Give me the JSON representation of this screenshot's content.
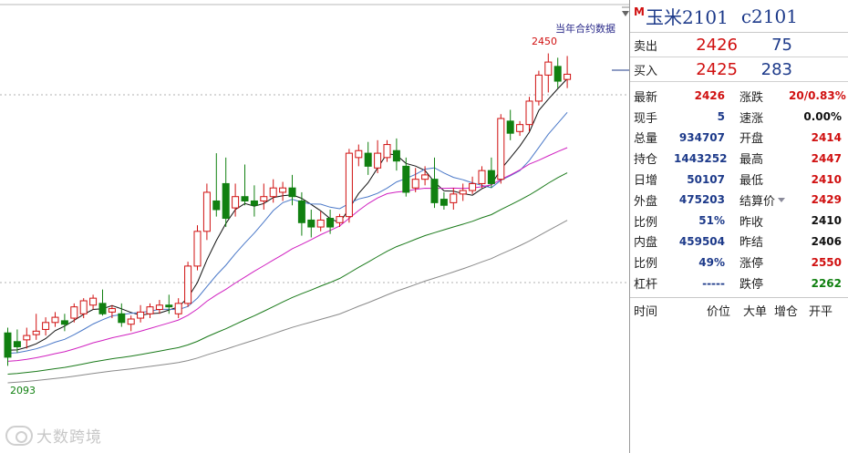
{
  "chart": {
    "annotation": "当年合约数据",
    "high_label": "2450",
    "low_label": "2093",
    "watermark": "大数跨境",
    "y_range": [
      2060,
      2480
    ],
    "candles": [
      [
        2128,
        2134,
        2100,
        2090
      ],
      [
        2118,
        2132,
        2112,
        2105
      ],
      [
        2120,
        2134,
        2125,
        2110
      ],
      [
        2126,
        2150,
        2130,
        2120
      ],
      [
        2132,
        2146,
        2140,
        2125
      ],
      [
        2140,
        2152,
        2146,
        2135
      ],
      [
        2142,
        2150,
        2138,
        2130
      ],
      [
        2145,
        2162,
        2158,
        2140
      ],
      [
        2150,
        2168,
        2165,
        2145
      ],
      [
        2160,
        2172,
        2168,
        2155
      ],
      [
        2162,
        2178,
        2150,
        2148
      ],
      [
        2152,
        2160,
        2156,
        2145
      ],
      [
        2150,
        2162,
        2140,
        2135
      ],
      [
        2138,
        2148,
        2144,
        2130
      ],
      [
        2145,
        2160,
        2152,
        2140
      ],
      [
        2150,
        2162,
        2158,
        2145
      ],
      [
        2155,
        2166,
        2160,
        2150
      ],
      [
        2160,
        2172,
        2158,
        2150
      ],
      [
        2150,
        2168,
        2162,
        2145
      ],
      [
        2162,
        2210,
        2205,
        2158
      ],
      [
        2205,
        2252,
        2245,
        2200
      ],
      [
        2245,
        2300,
        2290,
        2235
      ],
      [
        2280,
        2335,
        2270,
        2262
      ],
      [
        2300,
        2330,
        2260,
        2250
      ],
      [
        2272,
        2300,
        2285,
        2262
      ],
      [
        2285,
        2322,
        2280,
        2275
      ],
      [
        2280,
        2298,
        2275,
        2262
      ],
      [
        2280,
        2300,
        2285,
        2270
      ],
      [
        2285,
        2305,
        2295,
        2278
      ],
      [
        2290,
        2302,
        2295,
        2280
      ],
      [
        2295,
        2310,
        2285,
        2275
      ],
      [
        2280,
        2290,
        2255,
        2240
      ],
      [
        2258,
        2270,
        2250,
        2238
      ],
      [
        2250,
        2268,
        2258,
        2245
      ],
      [
        2260,
        2270,
        2250,
        2242
      ],
      [
        2255,
        2265,
        2262,
        2250
      ],
      [
        2262,
        2340,
        2335,
        2255
      ],
      [
        2330,
        2345,
        2338,
        2320
      ],
      [
        2335,
        2348,
        2320,
        2310
      ],
      [
        2318,
        2350,
        2335,
        2312
      ],
      [
        2330,
        2350,
        2345,
        2325
      ],
      [
        2338,
        2352,
        2326,
        2315
      ],
      [
        2320,
        2330,
        2290,
        2285
      ],
      [
        2295,
        2318,
        2305,
        2290
      ],
      [
        2305,
        2320,
        2310,
        2298
      ],
      [
        2305,
        2330,
        2278,
        2272
      ],
      [
        2282,
        2290,
        2275,
        2270
      ],
      [
        2278,
        2295,
        2288,
        2270
      ],
      [
        2288,
        2300,
        2292,
        2280
      ],
      [
        2292,
        2308,
        2300,
        2288
      ],
      [
        2300,
        2320,
        2315,
        2295
      ],
      [
        2315,
        2330,
        2300,
        2295
      ],
      [
        2305,
        2380,
        2375,
        2300
      ],
      [
        2372,
        2385,
        2358,
        2350
      ],
      [
        2360,
        2372,
        2368,
        2355
      ],
      [
        2368,
        2400,
        2395,
        2360
      ],
      [
        2395,
        2430,
        2425,
        2390
      ],
      [
        2425,
        2450,
        2440,
        2405
      ],
      [
        2435,
        2445,
        2418,
        2410
      ],
      [
        2420,
        2447,
        2426,
        2410
      ]
    ]
  },
  "panel": {
    "badge": "M",
    "name": "玉米2101",
    "code": "c2101",
    "sell": {
      "label": "卖出",
      "price": "2426",
      "volume": "75"
    },
    "buy": {
      "label": "买入",
      "price": "2425",
      "volume": "283"
    },
    "stats": [
      {
        "l1": "最新",
        "v1": "2426",
        "c1": "red",
        "l2": "涨跌",
        "v2": "20/0.83%",
        "c2": "red"
      },
      {
        "l1": "现手",
        "v1": "5",
        "c1": "blu",
        "l2": "速涨",
        "v2": "0.00%",
        "c2": "blk"
      },
      {
        "l1": "总量",
        "v1": "934707",
        "c1": "blu",
        "l2": "开盘",
        "v2": "2414",
        "c2": "red"
      },
      {
        "l1": "持仓",
        "v1": "1443252",
        "c1": "blu",
        "l2": "最高",
        "v2": "2447",
        "c2": "red"
      },
      {
        "l1": "日增",
        "v1": "50107",
        "c1": "blu",
        "l2": "最低",
        "v2": "2410",
        "c2": "red"
      },
      {
        "l1": "外盘",
        "v1": "475203",
        "c1": "red",
        "l2": "结算价",
        "v2": "2429",
        "c2": "red"
      },
      {
        "l1": "比例",
        "v1": "51%",
        "c1": "red",
        "l2": "昨收",
        "v2": "2410",
        "c2": "blk"
      },
      {
        "l1": "内盘",
        "v1": "459504",
        "c1": "blu",
        "l2": "昨结",
        "v2": "2406",
        "c2": "blk"
      },
      {
        "l1": "比例",
        "v1": "49%",
        "c1": "blu",
        "l2": "涨停",
        "v2": "2550",
        "c2": "red"
      },
      {
        "l1": "杠杆",
        "v1": "-----",
        "c1": "blu",
        "l2": "跌停",
        "v2": "2262",
        "c2": "grn"
      }
    ],
    "tape_headers": [
      "时间",
      "价位",
      "大单",
      "增仓",
      "开平"
    ]
  },
  "colors": {
    "up": "#d01010",
    "down": "#108010",
    "ma5": "#111111",
    "ma10": "#4a78c8",
    "ma20": "#d020c0",
    "ma40": "#1a7a1a",
    "ma60": "#8a8a8a"
  }
}
